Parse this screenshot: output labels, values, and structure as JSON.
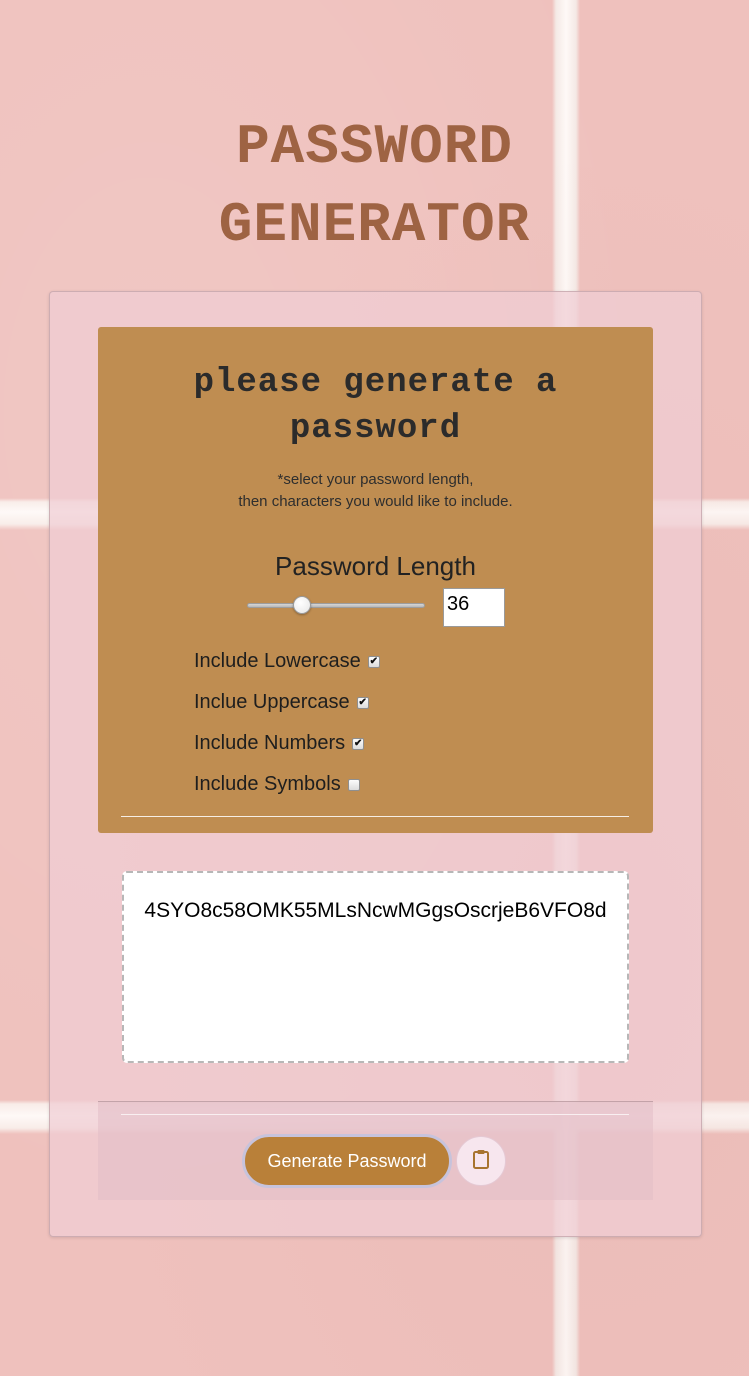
{
  "header": {
    "title_line1": "PASSWORD",
    "title_line2": "GENERATOR"
  },
  "panel": {
    "heading_line1": "please generate a",
    "heading_line2": "password",
    "hint_line1": "*select your password length,",
    "hint_line2": "then characters you would like to include."
  },
  "length": {
    "label": "Password Length",
    "value": "36",
    "slider_fraction": 0.29
  },
  "options": [
    {
      "label": "Include Lowercase",
      "checked": true
    },
    {
      "label": "Inclue Uppercase",
      "checked": true
    },
    {
      "label": "Include Numbers",
      "checked": true
    },
    {
      "label": "Include Symbols",
      "checked": false
    }
  ],
  "output": {
    "password": "4SYO8c58OMK55MLsNcwMGgsOscrjeB6VFO8d"
  },
  "actions": {
    "generate_label": "Generate Password",
    "copy_icon": "clipboard-icon"
  },
  "colors": {
    "title": "#9e6343",
    "panel": "#bf8d51",
    "button": "#b98039",
    "background": "#efc1bd"
  }
}
